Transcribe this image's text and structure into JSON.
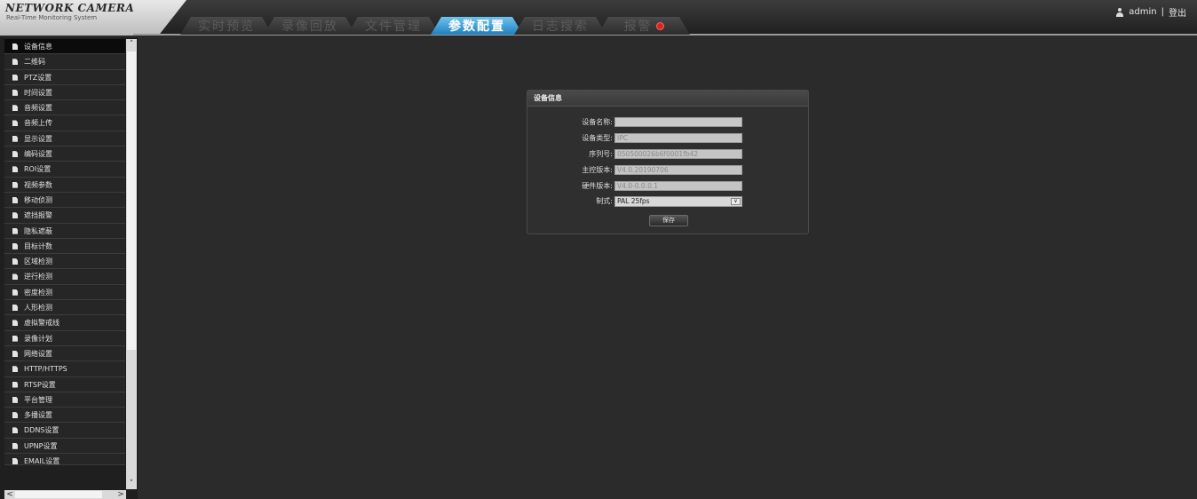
{
  "header": {
    "logo_title": "NETWORK CAMERA",
    "logo_subtitle": "Real-Time Monitoring System",
    "tabs": [
      {
        "label": "实时预览"
      },
      {
        "label": "录像回放"
      },
      {
        "label": "文件管理"
      },
      {
        "label": "参数配置"
      },
      {
        "label": "日志搜索"
      },
      {
        "label": "报警"
      }
    ],
    "active_tab": "参数配置",
    "user": "admin",
    "separator": "|",
    "logout_label": "登出"
  },
  "sidebar": {
    "items": [
      {
        "label": "设备信息"
      },
      {
        "label": "二维码"
      },
      {
        "label": "PTZ设置"
      },
      {
        "label": "时间设置"
      },
      {
        "label": "音频设置"
      },
      {
        "label": "音频上传"
      },
      {
        "label": "显示设置"
      },
      {
        "label": "编码设置"
      },
      {
        "label": "ROI设置"
      },
      {
        "label": "视频参数"
      },
      {
        "label": "移动侦测"
      },
      {
        "label": "遮挡报警"
      },
      {
        "label": "隐私遮蔽"
      },
      {
        "label": "目标计数"
      },
      {
        "label": "区域检测"
      },
      {
        "label": "逆行检测"
      },
      {
        "label": "密度检测"
      },
      {
        "label": "人形检测"
      },
      {
        "label": "虚拟警戒线"
      },
      {
        "label": "录像计划"
      },
      {
        "label": "网络设置"
      },
      {
        "label": "HTTP/HTTPS"
      },
      {
        "label": "RTSP设置"
      },
      {
        "label": "平台管理"
      },
      {
        "label": "多播设置"
      },
      {
        "label": "DDNS设置"
      },
      {
        "label": "UPNP设置"
      },
      {
        "label": "EMAIL设置"
      }
    ],
    "active_item": "设备信息"
  },
  "panel": {
    "title": "设备信息",
    "fields": [
      {
        "label": "设备名称:",
        "value": ""
      },
      {
        "label": "设备类型:",
        "value": "IPC"
      },
      {
        "label": "序列号:",
        "value": "050500026b6f0001fb42"
      },
      {
        "label": "主控版本:",
        "value": "V4.0.20190706"
      },
      {
        "label": "硬件版本:",
        "value": "V4.0-0.0.0.1"
      }
    ],
    "standard_label": "制式:",
    "standard_value": "PAL 25fps",
    "save_label": "保存"
  },
  "colors": {
    "accent": "#2a8fd0",
    "background": "#2b2b2b",
    "sidebar": "#1f1f1f",
    "alarm": "#d8261e"
  }
}
